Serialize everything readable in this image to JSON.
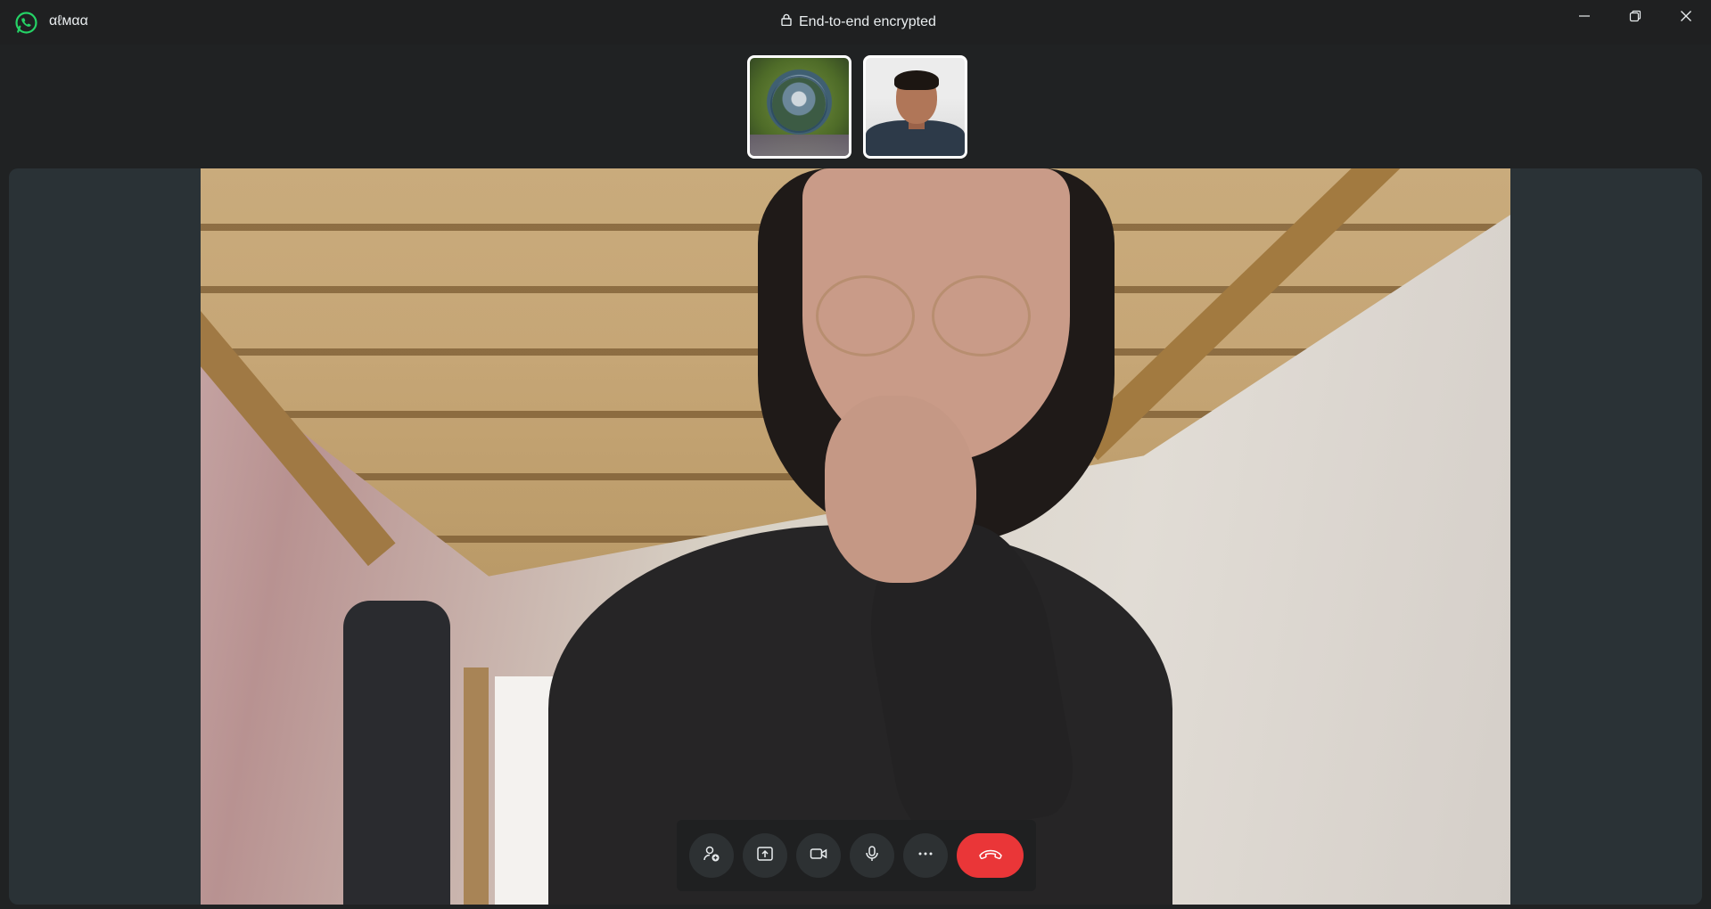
{
  "titlebar": {
    "app_title": "αℓмαα",
    "encryption_text": "End-to-end encrypted",
    "icons": {
      "app_logo": "whatsapp-logo",
      "lock": "lock-icon",
      "minimize": "minimize-icon",
      "restore": "restore-icon",
      "close": "close-icon"
    }
  },
  "participants": [
    {
      "id": "thumb-1",
      "kind": "profile-avatar"
    },
    {
      "id": "thumb-2",
      "kind": "camera-feed"
    }
  ],
  "controls": {
    "buttons": [
      {
        "name": "add-participant",
        "icon": "add-person-icon"
      },
      {
        "name": "share-screen",
        "icon": "share-screen-icon"
      },
      {
        "name": "video",
        "icon": "video-camera-icon"
      },
      {
        "name": "microphone",
        "icon": "microphone-icon"
      },
      {
        "name": "more",
        "icon": "more-horizontal-icon"
      },
      {
        "name": "end-call",
        "icon": "phone-hangup-icon"
      }
    ]
  },
  "colors": {
    "brand_green": "#25D366",
    "end_call_red": "#EA3638",
    "background": "#202223"
  }
}
